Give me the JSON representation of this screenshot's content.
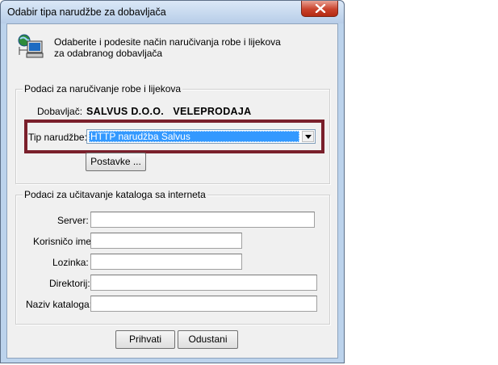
{
  "window": {
    "title": "Odabir tipa narudžbe za dobavljača"
  },
  "header": {
    "description": "Odaberite i podesite način naručivanja robe i lijekova\nza odabranog dobavljača",
    "icon": "network-computer-icon"
  },
  "order_group": {
    "title": "Podaci za naručivanje robe i lijekova",
    "supplier_label": "Dobavljač:",
    "supplier_value": "SALVUS D.O.O.   VELEPRODAJA",
    "order_type_label": "Tip narudžbe:",
    "order_type_value": "HTTP narudžba Salvus",
    "settings_button": "Postavke ..."
  },
  "catalog_group": {
    "title": "Podaci za učitavanje kataloga sa interneta",
    "fields": [
      {
        "label": "Server:",
        "value": ""
      },
      {
        "label": "Korisničo ime:",
        "value": ""
      },
      {
        "label": "Lozinka:",
        "value": ""
      },
      {
        "label": "Direktorij:",
        "value": ""
      },
      {
        "label": "Naziv kataloga:",
        "value": ""
      }
    ]
  },
  "buttons": {
    "ok": "Prihvati",
    "cancel": "Odustani"
  },
  "colors": {
    "highlight_border": "#7a1f2b",
    "selection": "#3399ff",
    "close_button": "#c9432c"
  }
}
